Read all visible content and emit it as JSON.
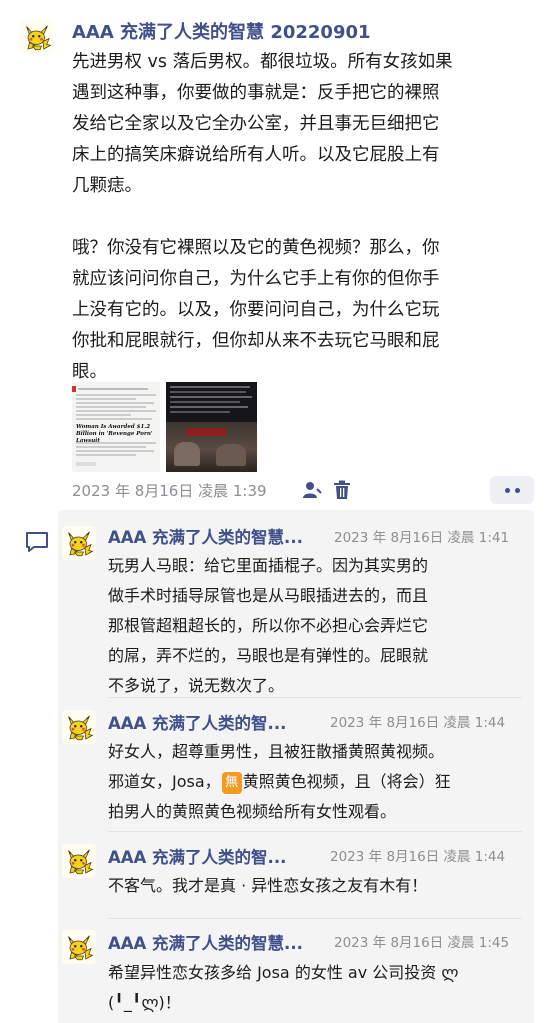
{
  "post": {
    "author": "AAA 充满了人类的智慧 20220901",
    "lines": [
      "先进男权 vs 落后男权。都很垃圾。所有女孩如果",
      "遇到这种事，你要做的事就是：反手把它的裸照",
      "发给它全家以及它全办公室，并且事无巨细把它",
      "床上的搞笑床癖说给所有人听。以及它屁股上有",
      "几颗痣。",
      "",
      "哦？你没有它裸照以及它的黄色视频？那么，你",
      "就应该问问你自己，为什么它手上有你的但你手",
      "上没有它的。以及，你要问问自己，为什么它玩",
      "你批和屁眼就行，但你却从来不去玩它马眼和屁",
      "眼。"
    ],
    "image1_headline": "Woman Is Awarded $1.2 Billion in 'Revenge Porn' Lawsuit",
    "timestamp": "2023 年 8月16日 凌晨 1:39"
  },
  "comments": [
    {
      "author": "AAA 充满了人类的智慧...",
      "timestamp": "2023 年 8月16日 凌晨 1:41",
      "lines": [
        "玩男人马眼：给它里面插棍子。因为其实男的",
        "做手术时插导尿管也是从马眼插进去的，而且",
        "那根管超粗超长的，所以你不必担心会弄烂它",
        "的屌，弄不烂的，马眼也是有弹性的。屁眼就",
        "不多说了，说无数次了。"
      ]
    },
    {
      "author": "AAA 充满了人类的智...",
      "timestamp": "2023 年 8月16日 凌晨 1:44",
      "line1": "好女人，超尊重男性，且被狂散播黄照黄视频。",
      "line2_before": "邪道女，Josa，",
      "badge": "無",
      "line2_after": "黄照黄色视频，且（将会）狂",
      "line3": "拍男人的黄照黄色视频给所有女性观看。"
    },
    {
      "author": "AAA 充满了人类的智...",
      "timestamp": "2023 年 8月16日 凌晨 1:44",
      "lines": [
        "不客气。我才是真 · 异性恋女孩之友有木有！"
      ]
    },
    {
      "author": "AAA 充满了人类的智慧...",
      "timestamp": "2023 年 8月16日 凌晨 1:45",
      "lines": [
        "希望异性恋女孩多给 Josa 的女性 av 公司投资 ლ",
        "(╹_╹ლ)！"
      ]
    }
  ],
  "colors": {
    "name": "#42508a",
    "meta": "#8e8e93",
    "panel": "#f4f4f4",
    "badge": "#f39a21"
  }
}
